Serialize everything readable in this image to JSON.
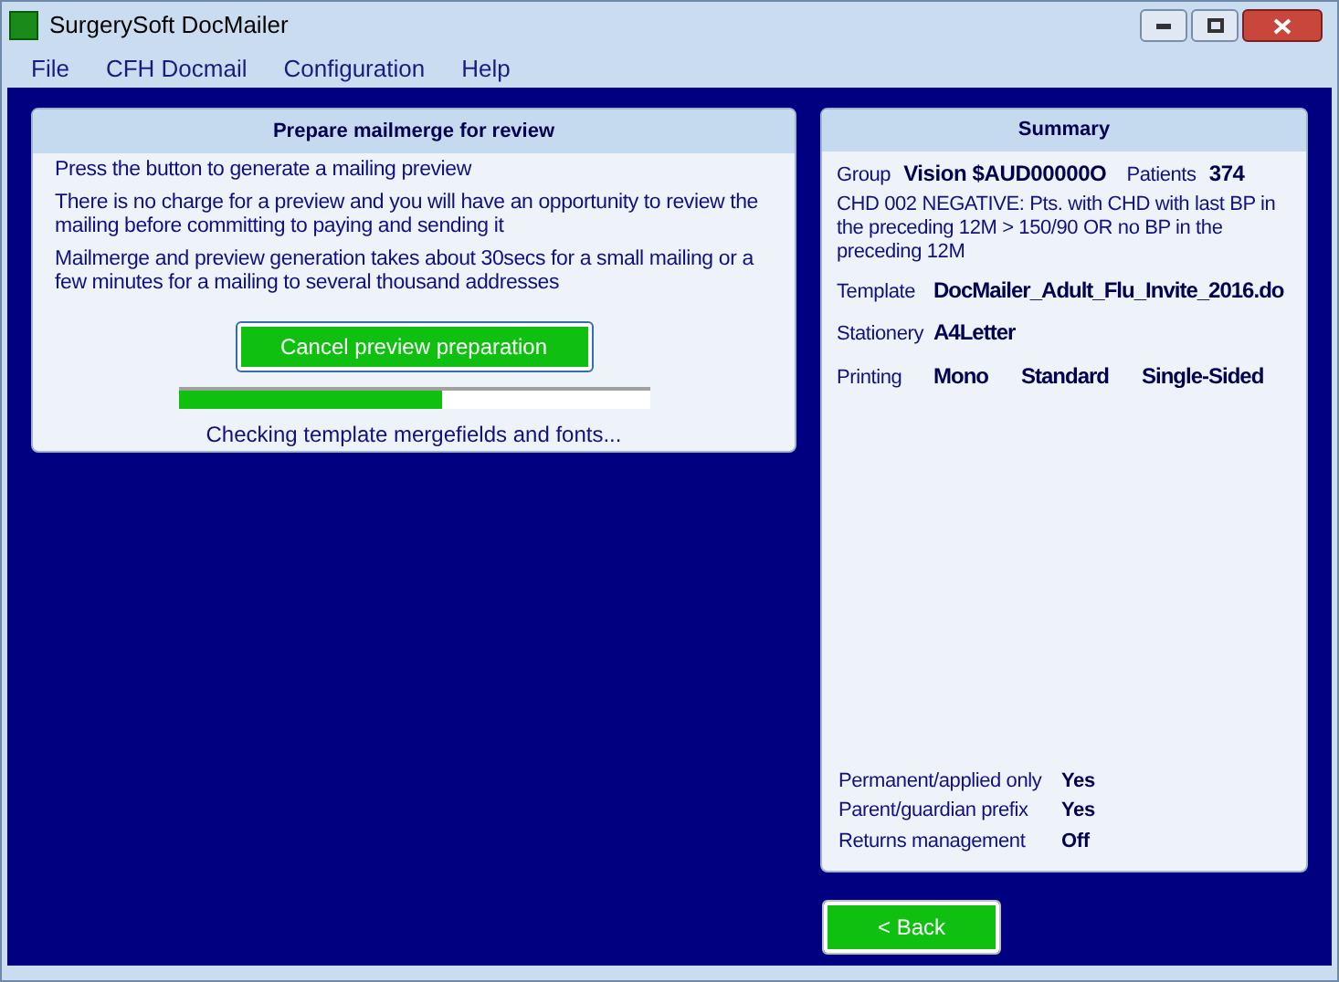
{
  "window": {
    "title": "SurgerySoft DocMailer"
  },
  "menu": [
    "File",
    "CFH Docmail",
    "Configuration",
    "Help"
  ],
  "prepare_panel": {
    "title": "Prepare mailmerge for review",
    "paragraphs": [
      "Press the button to generate a mailing preview",
      "There is no charge for a preview and you will have an opportunity to review the mailing before committing to paying and sending it",
      "Mailmerge and preview generation takes about 30secs for a small mailing or a few minutes for a mailing to several thousand addresses"
    ],
    "button": "Cancel preview preparation",
    "progress": {
      "level": 0.56
    },
    "status": "Checking template mergefields and fonts..."
  },
  "summary": {
    "title": "Summary",
    "group_label": "Group",
    "group_value": "Vision $AUD00000O",
    "patients_label": "Patients",
    "patients_value": "374",
    "description": "CHD 002 NEGATIVE: Pts. with CHD with last BP in the preceding 12M > 150/90 OR no BP in the preceding 12M",
    "rows": [
      {
        "label": "Template",
        "values": [
          "DocMailer_Adult_Flu_Invite_2016.do"
        ]
      },
      {
        "label": "Stationery",
        "values": [
          "A4Letter"
        ]
      },
      {
        "label": "Printing",
        "values": [
          "Mono",
          "Standard",
          "Single-Sided"
        ]
      }
    ],
    "options": [
      {
        "label": "Permanent/applied only",
        "value": "Yes"
      },
      {
        "label": "Parent/guardian prefix",
        "value": "Yes"
      },
      {
        "label": "Returns management",
        "value": "Off"
      }
    ]
  },
  "back_button": "< Back"
}
